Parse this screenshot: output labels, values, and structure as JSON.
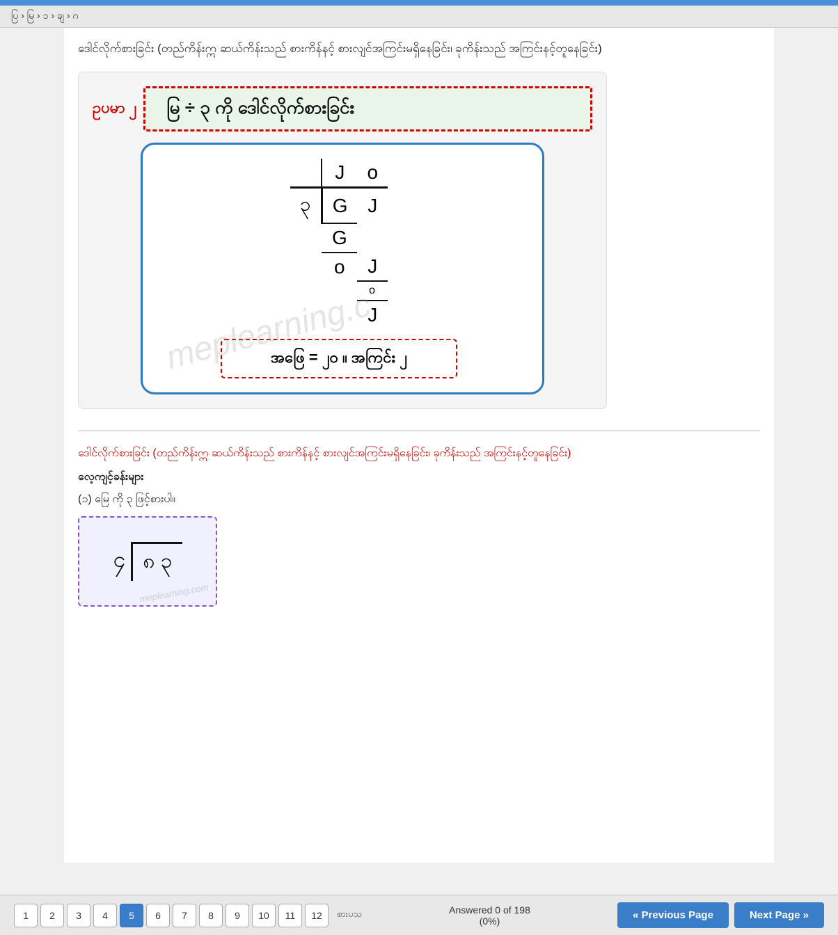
{
  "topBar": {
    "navText": "ပြ › မြ › ၁ › ချ › ဂ"
  },
  "instructionSection": {
    "title": "ဒေါင်လိုက်စားခြင်း (တည်ကိန်းဣ ဆယ်ကိန်းသည် စားကိန်နင့် စားလျင်အကြင်းမရှိနေခြင်း၊ ခုကိန်းသည် အကြင်းနင့်တူနေခြင်း)"
  },
  "exampleSection": {
    "label": "ဥပမာ ၂",
    "titleBoxText": "မြ ÷ ၃  ကို ဒေါင်လိုက်စားခြင်း",
    "diagramRows": [
      {
        "left": "",
        "right": "J",
        "extra": "o"
      },
      {
        "left": "၃",
        "right": "G",
        "extra": "J"
      },
      {
        "left": "",
        "right": "G",
        "extra": ""
      },
      {
        "left": "",
        "right": "o",
        "extra": "J"
      },
      {
        "left": "",
        "right": "",
        "extra": "o"
      },
      {
        "left": "",
        "right": "",
        "extra": "J"
      }
    ],
    "answerText": "အဖြေ = ၂၀ ။  အကြင်း ၂",
    "watermark": "meplearning.c"
  },
  "practiceSection": {
    "instructionText": "ဒေါင်လိုက်စားခြင်း (တည်ကိန်းဣ ဆယ်ကိန်းသည် စားကိန်နင့် စားလျင်အကြင်းမရှိနေခြင်း၊ ခုကိန်းသည် အကြင်းနင့်တူနေခြင်း)",
    "sectionLabel": "လေ့ကျင့်ခန်းများ",
    "item1Text": "(၁) မြေ ကို ၃ ဖြင့်စားပါ။",
    "item1Numbers": {
      "dividend": "၄",
      "divisorTop": "၈",
      "divisorBottom": "၃"
    },
    "watermark2": "meplearning.com"
  },
  "bottomBar": {
    "pages": [
      "1",
      "2",
      "3",
      "4",
      "5",
      "6",
      "7",
      "8",
      "9",
      "10",
      "11",
      "12"
    ],
    "activePage": "5",
    "answeredText": "Answered 0 of 198",
    "percentText": "(0%)",
    "prevLabel": "« Previous Page",
    "nextLabel": "Next Page »",
    "tagLabel": "စားပသ"
  }
}
